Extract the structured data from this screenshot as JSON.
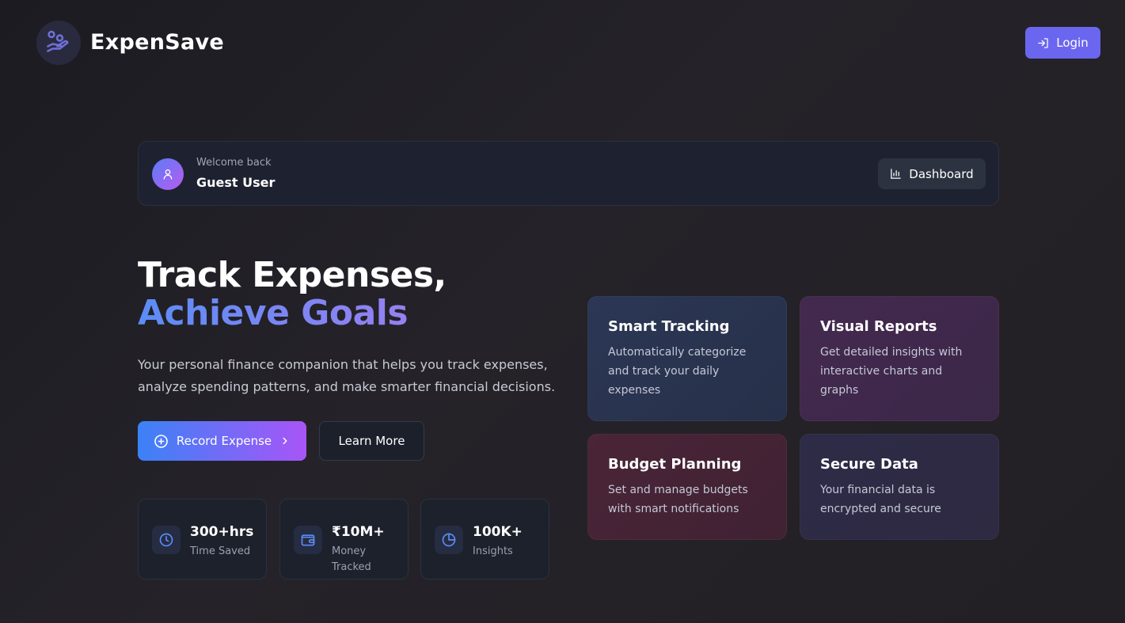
{
  "app": {
    "brand": "ExpenSave"
  },
  "header": {
    "login_label": "Login"
  },
  "welcome": {
    "subtitle": "Welcome back",
    "name": "Guest User",
    "dashboard_label": "Dashboard"
  },
  "hero": {
    "title_line1": "Track Expenses,",
    "title_line2": "Achieve Goals",
    "description": "Your personal finance companion that helps you track expenses, analyze spending patterns, and make smarter financial decisions.",
    "primary_button": "Record Expense",
    "secondary_button": "Learn More"
  },
  "stats": [
    {
      "value": "300+hrs",
      "label": "Time Saved",
      "icon": "clock-icon"
    },
    {
      "value": "₹10M+",
      "label": "Money Tracked",
      "icon": "wallet-icon"
    },
    {
      "value": "100K+",
      "label": "Insights",
      "icon": "pie-chart-icon"
    }
  ],
  "features": [
    {
      "title": "Smart Tracking",
      "description": "Automatically categorize and track your daily expenses"
    },
    {
      "title": "Visual Reports",
      "description": "Get detailed insights with interactive charts and graphs"
    },
    {
      "title": "Budget Planning",
      "description": "Set and manage budgets with smart notifications"
    },
    {
      "title": "Secure Data",
      "description": "Your financial data is encrypted and secure"
    }
  ],
  "colors": {
    "accent": "#6b66f0",
    "gradient_start": "#3b82f6",
    "gradient_end": "#a855f7"
  }
}
